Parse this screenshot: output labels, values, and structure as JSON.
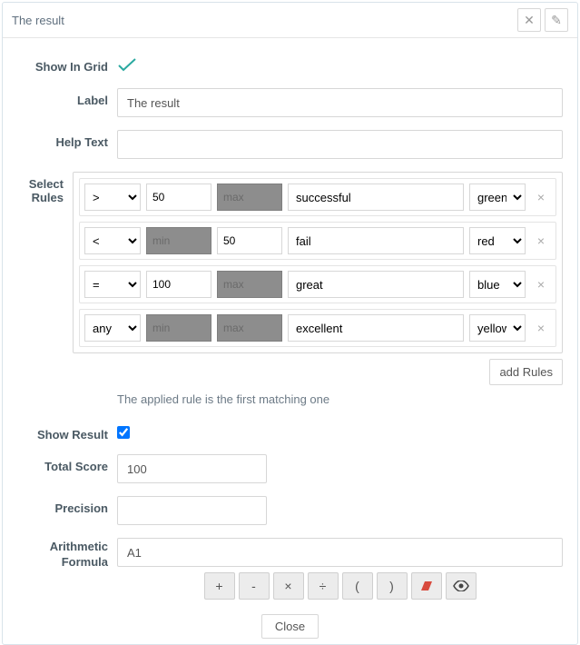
{
  "header": {
    "title": "The result"
  },
  "labels": {
    "show_in_grid": "Show In Grid",
    "label": "Label",
    "help_text": "Help Text",
    "select_rules": "Select Rules",
    "show_result": "Show Result",
    "total_score": "Total Score",
    "precision": "Precision",
    "formula_line1": "Arithmetic",
    "formula_line2": "Formula"
  },
  "fields": {
    "label_value": "The result",
    "help_text_value": "",
    "total_score_value": "100",
    "precision_value": "",
    "formula_value": "A1",
    "show_result_checked": true
  },
  "rules": {
    "hint": "The applied rule is the first matching one",
    "add_button": "add Rules",
    "min_placeholder": "min",
    "max_placeholder": "max",
    "items": [
      {
        "op": ">",
        "min": "50",
        "min_disabled": false,
        "max": "",
        "max_disabled": true,
        "text": "successful",
        "color": "green"
      },
      {
        "op": "<",
        "min": "",
        "min_disabled": true,
        "max": "50",
        "max_disabled": false,
        "text": "fail",
        "color": "red"
      },
      {
        "op": "=",
        "min": "100",
        "min_disabled": false,
        "max": "",
        "max_disabled": true,
        "text": "great",
        "color": "blue"
      },
      {
        "op": "any",
        "min": "",
        "min_disabled": true,
        "max": "",
        "max_disabled": true,
        "text": "excellent",
        "color": "yellow"
      }
    ]
  },
  "formula_buttons": {
    "plus": "+",
    "minus": "-",
    "times": "×",
    "divide": "÷",
    "lparen": "(",
    "rparen": ")"
  },
  "footer": {
    "close": "Close"
  }
}
